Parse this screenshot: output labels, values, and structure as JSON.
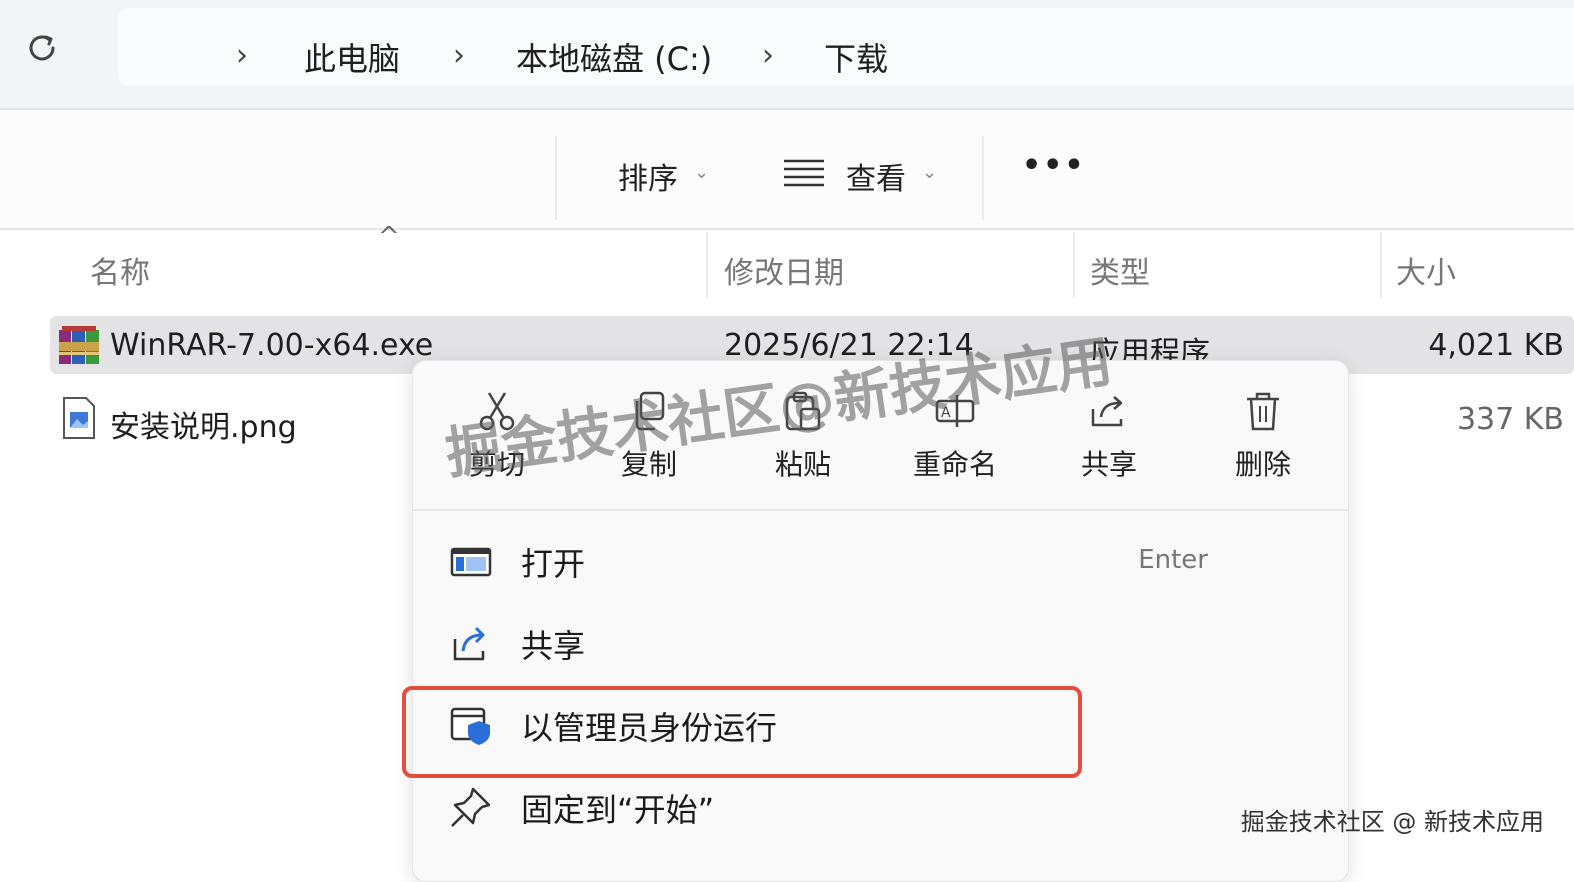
{
  "breadcrumb": {
    "items": [
      "此电脑",
      "本地磁盘 (C:)",
      "下载"
    ]
  },
  "toolbar": {
    "sort_label": "排序",
    "view_label": "查看",
    "more_label": "•••"
  },
  "columns": {
    "name": "名称",
    "date": "修改日期",
    "type": "类型",
    "size": "大小"
  },
  "files": [
    {
      "name": "WinRAR-7.00-x64.exe",
      "date": "2025/6/21 22:14",
      "type": "应用程序",
      "size": "4,021 KB",
      "icon": "winrar-icon"
    },
    {
      "name": "安装说明.png",
      "date": "",
      "type": "",
      "size": "337 KB",
      "icon": "image-file-icon"
    }
  ],
  "context_menu": {
    "quick_actions": [
      {
        "label": "剪切",
        "icon": "scissors-icon"
      },
      {
        "label": "复制",
        "icon": "copy-icon"
      },
      {
        "label": "粘贴",
        "icon": "paste-icon"
      },
      {
        "label": "重命名",
        "icon": "rename-icon"
      },
      {
        "label": "共享",
        "icon": "share-icon"
      },
      {
        "label": "删除",
        "icon": "trash-icon"
      }
    ],
    "items": [
      {
        "label": "打开",
        "shortcut": "Enter",
        "icon": "open-window-icon"
      },
      {
        "label": "共享",
        "shortcut": "",
        "icon": "share-icon"
      },
      {
        "label": "以管理员身份运行",
        "shortcut": "",
        "icon": "admin-shield-icon"
      },
      {
        "label": "固定到“开始”",
        "shortcut": "",
        "icon": "pin-icon"
      }
    ]
  },
  "watermark": {
    "center": "掘金技术社区@新技术应用",
    "corner": "掘金技术社区 @ 新技术应用"
  },
  "colors": {
    "highlight_border": "#e34d3c",
    "accent": "#2b6fd6"
  }
}
